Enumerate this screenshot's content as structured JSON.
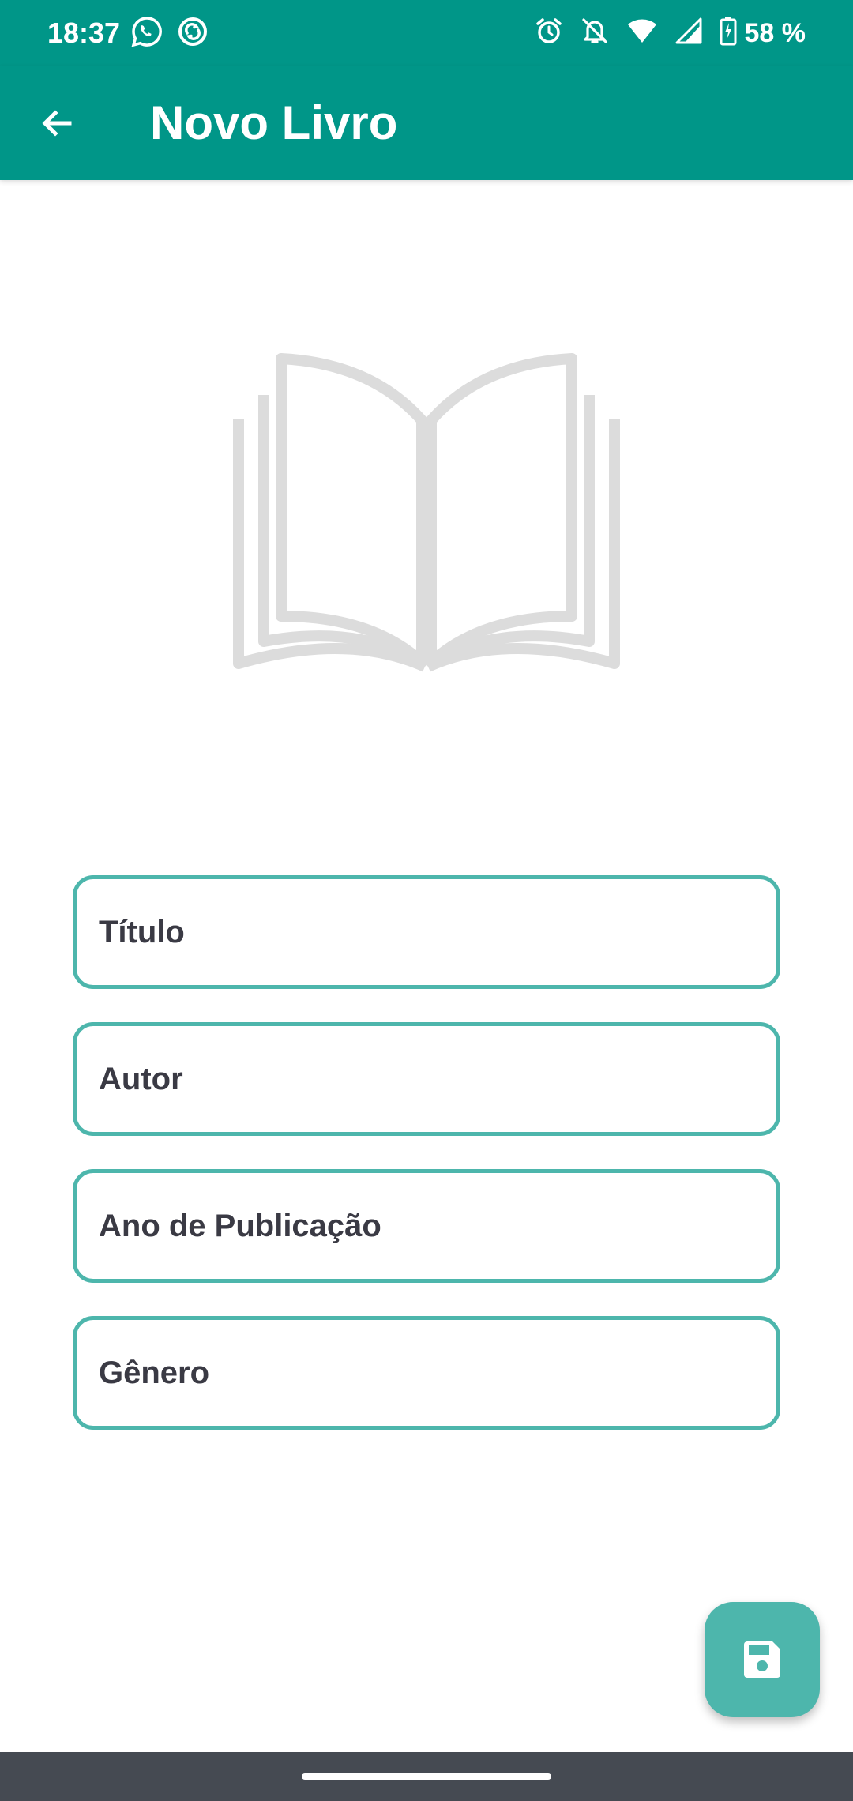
{
  "status_bar": {
    "time": "18:37",
    "left_icons": [
      "whatsapp-icon",
      "sync-icon"
    ],
    "right_icons": [
      "alarm-icon",
      "notifications-off-icon",
      "wifi-icon",
      "cellular-signal-icon",
      "battery-charging-icon"
    ],
    "battery": "58 %"
  },
  "app_bar": {
    "back_icon": "arrow-back-icon",
    "title": "Novo Livro",
    "color": "#009688"
  },
  "cover": {
    "icon": "open-book-placeholder-icon",
    "color": "#dcdcdc"
  },
  "form": {
    "fields": [
      {
        "placeholder": "Título",
        "value": ""
      },
      {
        "placeholder": "Autor",
        "value": ""
      },
      {
        "placeholder": "Ano de Publicação",
        "value": ""
      },
      {
        "placeholder": "Gênero",
        "value": ""
      }
    ],
    "border_color": "#4db6ac"
  },
  "fab": {
    "icon": "save-icon",
    "color": "#4db6ac"
  },
  "nav_bar": {
    "color": "#454a52"
  }
}
